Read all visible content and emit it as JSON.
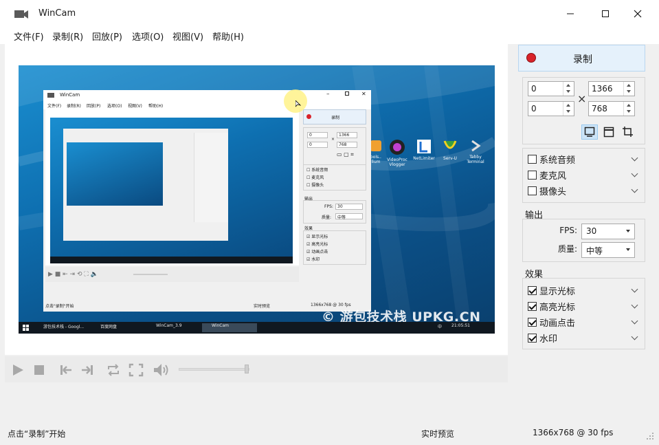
{
  "window": {
    "title": "WinCam"
  },
  "menu": [
    {
      "label": "文件(F)"
    },
    {
      "label": "录制(R)"
    },
    {
      "label": "回放(P)"
    },
    {
      "label": "选项(O)"
    },
    {
      "label": "视图(V)"
    },
    {
      "label": "帮助(H)"
    }
  ],
  "preview": {
    "inner_window": {
      "title": "WinCam",
      "menu": [
        "文件(F)",
        "录制(R)",
        "回放(P)",
        "选项(O)",
        "视图(V)",
        "帮助(H)"
      ],
      "record_label": "录制",
      "x": "0",
      "y": "0",
      "w": "1366",
      "h": "768",
      "audio": [
        "系统音频",
        "麦克风",
        "摄像头"
      ],
      "output_label": "输出",
      "fps_label": "FPS:",
      "fps_value": "30",
      "quality_label": "质量:",
      "quality_value": "中等",
      "effects_label": "效果",
      "effects": [
        "显示光标",
        "高亮光标",
        "动画点击",
        "水印"
      ],
      "status_left": "点击\"录制\"开始",
      "status_mid": "实时预览",
      "status_right": "1366x768 @ 30 fps"
    },
    "desktop_icons": [
      "ools..\nlium",
      "VideoProc\nVlogger",
      "NetLimiter",
      "Serv-U",
      "Tabby\nTerminal"
    ],
    "watermark": "© 游包技术栈 UPKG.CN",
    "taskbar": {
      "items": [
        "游包技术栈 - Googl...",
        "百度网盘",
        "WinCam_3.9",
        "WinCam"
      ],
      "clock": "21:05:51",
      "ime": "中"
    }
  },
  "controls": {
    "play": "play-icon",
    "stop": "stop-icon",
    "prev": "skip-back-icon",
    "next": "skip-forward-icon",
    "loop": "loop-icon",
    "fullscreen": "fullscreen-icon",
    "volume": "volume-icon"
  },
  "panel": {
    "record_label": "录制",
    "record_color": "#d8232a",
    "x": "0",
    "y": "0",
    "width": "1366",
    "height": "768",
    "times": "×",
    "audio": [
      {
        "label": "系统音频",
        "checked": false
      },
      {
        "label": "麦克风",
        "checked": false
      },
      {
        "label": "摄像头",
        "checked": false
      }
    ],
    "output_label": "输出",
    "fps_label": "FPS:",
    "fps_value": "30",
    "quality_label": "质量:",
    "quality_value": "中等",
    "effects_label": "效果",
    "effects": [
      {
        "label": "显示光标",
        "checked": true
      },
      {
        "label": "高亮光标",
        "checked": true
      },
      {
        "label": "动画点击",
        "checked": true
      },
      {
        "label": "水印",
        "checked": true
      }
    ]
  },
  "status": {
    "left": "点击“录制”开始",
    "middle": "实时预览",
    "right": "1366x768 @ 30 fps"
  }
}
